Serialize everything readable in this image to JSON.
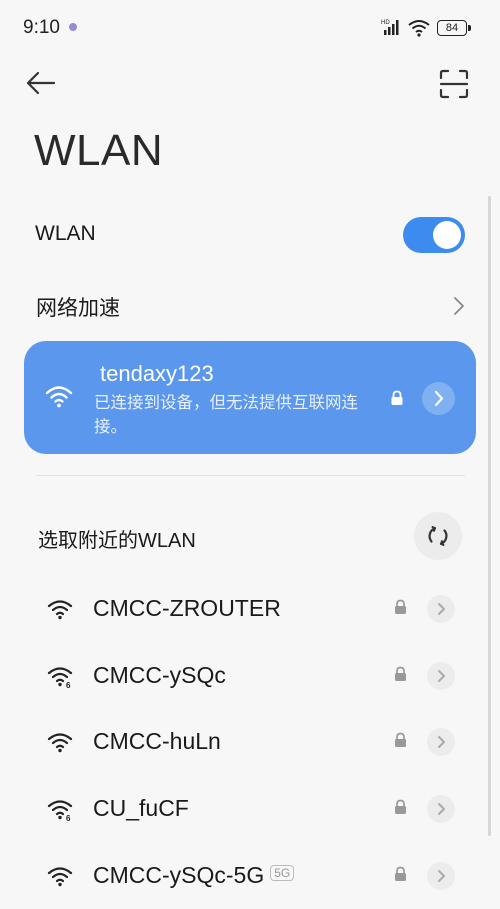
{
  "status_bar": {
    "time": "9:10",
    "signal_label": "HD",
    "battery": "84",
    "icons": [
      "status-app-dot-icon",
      "signal-icon",
      "wifi-icon",
      "battery-icon"
    ]
  },
  "header": {
    "back_icon": "arrow-left-icon",
    "scan_icon": "scan-icon",
    "title": "WLAN"
  },
  "wlan_toggle": {
    "label": "WLAN",
    "enabled": true,
    "accent": "#3e8bf0"
  },
  "network_accel": {
    "label": "网络加速",
    "icon": "chevron-right-icon"
  },
  "connected_network": {
    "ssid": "tendaxy123",
    "status": "已连接到设备，但无法提供互联网连接。",
    "locked": true,
    "card_color": "#5b97ec"
  },
  "nearby": {
    "label": "选取附近的WLAN",
    "refresh_icon": "refresh-icon",
    "networks": [
      {
        "ssid": "CMCC-ZROUTER",
        "wifi6": false,
        "badge": ""
      },
      {
        "ssid": "CMCC-ySQc",
        "wifi6": true,
        "badge": ""
      },
      {
        "ssid": "CMCC-huLn",
        "wifi6": false,
        "badge": ""
      },
      {
        "ssid": "CU_fuCF",
        "wifi6": true,
        "badge": ""
      },
      {
        "ssid": "CMCC-ySQc-5G",
        "wifi6": false,
        "badge": "5G"
      }
    ]
  }
}
